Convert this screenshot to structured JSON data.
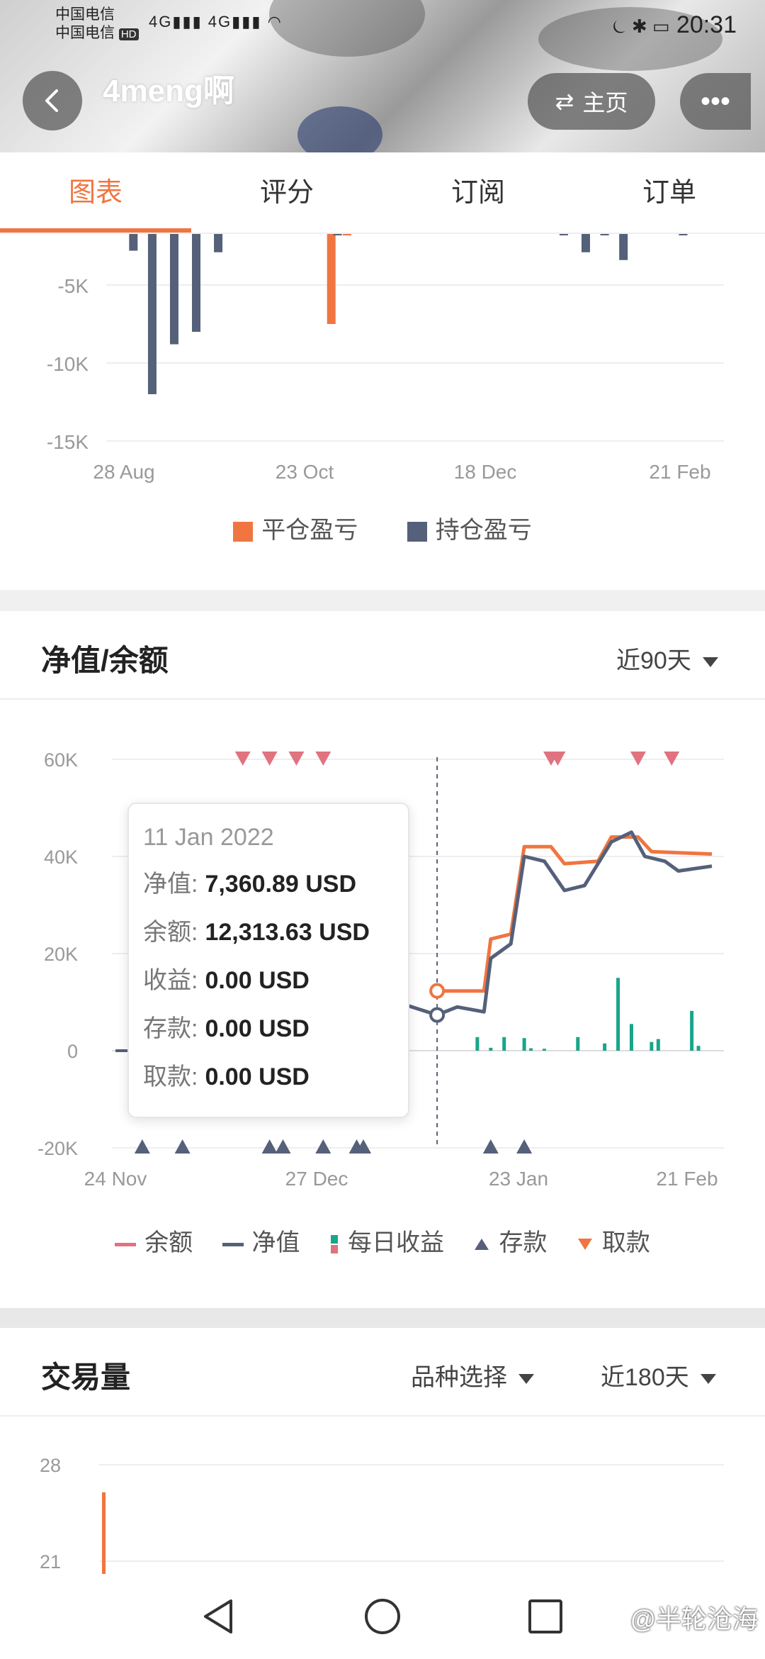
{
  "status_bar": {
    "carrier1": "中国电信",
    "carrier2": "中国电信",
    "carrier2_badge": "HD",
    "network": "4G",
    "time": "20:31"
  },
  "header": {
    "username": "4meng啊",
    "home_label": "主页",
    "more_label": "•••"
  },
  "tabs": [
    {
      "label": "图表",
      "active": true
    },
    {
      "label": "评分",
      "active": false
    },
    {
      "label": "订阅",
      "active": false
    },
    {
      "label": "订单",
      "active": false
    }
  ],
  "pnl_chart": {
    "legend": [
      {
        "label": "平仓盈亏",
        "color": "#f07540"
      },
      {
        "label": "持仓盈亏",
        "color": "#55607a"
      }
    ]
  },
  "equity_section": {
    "title": "净值/余额",
    "range_select": "近90天",
    "tooltip": {
      "date": "11 Jan 2022",
      "rows": [
        {
          "label": "净值:",
          "value": "7,360.89 USD"
        },
        {
          "label": "余额:",
          "value": "12,313.63 USD"
        },
        {
          "label": "收益:",
          "value": "0.00 USD"
        },
        {
          "label": "存款:",
          "value": "0.00 USD"
        },
        {
          "label": "取款:",
          "value": "0.00 USD"
        }
      ]
    },
    "legend": [
      {
        "label": "余额",
        "color": "#e0737f",
        "marker": "dash"
      },
      {
        "label": "净值",
        "color": "#55607a",
        "marker": "dash"
      },
      {
        "label": "每日收益",
        "color": "#1aa58a",
        "marker": "bars"
      },
      {
        "label": "存款",
        "color": "#55607a",
        "marker": "triangle-up"
      },
      {
        "label": "取款",
        "color": "#f07540",
        "marker": "triangle-down"
      }
    ]
  },
  "volume_section": {
    "title": "交易量",
    "symbol_select": "品种选择",
    "range_select": "近180天"
  },
  "watermark": "@半轮沧海",
  "chart_data": [
    {
      "type": "bar",
      "x_ticks": [
        "28 Aug",
        "23 Oct",
        "18 Dec",
        "21 Feb"
      ],
      "y_ticks": [
        "-5K",
        "-10K",
        "-15K"
      ],
      "ylim": [
        -15000,
        0
      ],
      "legend_position": "bottom",
      "series": [
        {
          "name": "平仓盈亏",
          "color": "#f07540",
          "points": [
            {
              "x": "2021-11-02",
              "y": -7500
            },
            {
              "x": "2021-11-07",
              "y": -1200
            }
          ]
        },
        {
          "name": "持仓盈亏",
          "color": "#55607a",
          "points": [
            {
              "x": "2021-08-31",
              "y": -2800
            },
            {
              "x": "2021-09-06",
              "y": -12000
            },
            {
              "x": "2021-09-13",
              "y": -8800
            },
            {
              "x": "2021-09-20",
              "y": -8000
            },
            {
              "x": "2021-09-27",
              "y": -2900
            },
            {
              "x": "2021-11-04",
              "y": -800
            },
            {
              "x": "2022-01-15",
              "y": -1600
            },
            {
              "x": "2022-01-22",
              "y": -2900
            },
            {
              "x": "2022-01-28",
              "y": -1000
            },
            {
              "x": "2022-02-03",
              "y": -3400
            },
            {
              "x": "2022-02-22",
              "y": -900
            }
          ]
        }
      ]
    },
    {
      "type": "line",
      "x_ticks": [
        "24 Nov",
        "27 Dec",
        "23 Jan",
        "21 Feb"
      ],
      "y_ticks": [
        "60K",
        "40K",
        "20K",
        "0",
        "-20K"
      ],
      "ylim": [
        -20000,
        60000
      ],
      "grid": true,
      "crosshair_x": "2022-01-11",
      "legend_position": "bottom",
      "series": [
        {
          "name": "余额",
          "color": "#f07540",
          "points": [
            {
              "x": "2022-01-11",
              "y": 12313
            },
            {
              "x": "2022-01-18",
              "y": 12313
            },
            {
              "x": "2022-01-19",
              "y": 23000
            },
            {
              "x": "2022-01-22",
              "y": 24000
            },
            {
              "x": "2022-01-24",
              "y": 42000
            },
            {
              "x": "2022-01-28",
              "y": 42000
            },
            {
              "x": "2022-01-30",
              "y": 38500
            },
            {
              "x": "2022-02-04",
              "y": 39000
            },
            {
              "x": "2022-02-06",
              "y": 44000
            },
            {
              "x": "2022-02-10",
              "y": 44000
            },
            {
              "x": "2022-02-12",
              "y": 41000
            },
            {
              "x": "2022-02-21",
              "y": 40500
            }
          ]
        },
        {
          "name": "净值",
          "color": "#55607a",
          "points": [
            {
              "x": "2022-01-05",
              "y": 10000
            },
            {
              "x": "2022-01-11",
              "y": 7360
            },
            {
              "x": "2022-01-14",
              "y": 9000
            },
            {
              "x": "2022-01-18",
              "y": 8000
            },
            {
              "x": "2022-01-19",
              "y": 19000
            },
            {
              "x": "2022-01-22",
              "y": 22000
            },
            {
              "x": "2022-01-24",
              "y": 40000
            },
            {
              "x": "2022-01-27",
              "y": 39000
            },
            {
              "x": "2022-01-30",
              "y": 33000
            },
            {
              "x": "2022-02-02",
              "y": 34000
            },
            {
              "x": "2022-02-06",
              "y": 43000
            },
            {
              "x": "2022-02-09",
              "y": 45000
            },
            {
              "x": "2022-02-11",
              "y": 40000
            },
            {
              "x": "2022-02-14",
              "y": 39000
            },
            {
              "x": "2022-02-16",
              "y": 37000
            },
            {
              "x": "2022-02-21",
              "y": 38000
            }
          ]
        },
        {
          "name": "每日收益",
          "color": "#1aa58a",
          "kind": "bar",
          "points": [
            {
              "x": "2022-01-17",
              "y": 2800
            },
            {
              "x": "2022-01-19",
              "y": 600
            },
            {
              "x": "2022-01-21",
              "y": 2800
            },
            {
              "x": "2022-01-24",
              "y": 2600
            },
            {
              "x": "2022-01-25",
              "y": 500
            },
            {
              "x": "2022-01-27",
              "y": 400
            },
            {
              "x": "2022-02-01",
              "y": 2800
            },
            {
              "x": "2022-02-05",
              "y": 1500
            },
            {
              "x": "2022-02-07",
              "y": 15000
            },
            {
              "x": "2022-02-09",
              "y": 5500
            },
            {
              "x": "2022-02-12",
              "y": 1800
            },
            {
              "x": "2022-02-13",
              "y": 2400
            },
            {
              "x": "2022-02-18",
              "y": 8200
            },
            {
              "x": "2022-02-19",
              "y": 1000
            }
          ]
        },
        {
          "name": "存款",
          "color": "#55607a",
          "kind": "marker-bottom",
          "x": [
            "2021-11-28",
            "2021-12-04",
            "2021-12-17",
            "2021-12-19",
            "2021-12-25",
            "2021-12-30",
            "2021-12-31",
            "2022-01-19",
            "2022-01-24"
          ]
        },
        {
          "name": "取款",
          "color": "#e0737f",
          "kind": "marker-top",
          "x": [
            "2021-12-13",
            "2021-12-17",
            "2021-12-21",
            "2021-12-25",
            "2022-01-28",
            "2022-01-29",
            "2022-02-10",
            "2022-02-15"
          ]
        }
      ]
    },
    {
      "type": "bar",
      "y_ticks": [
        "28",
        "21"
      ],
      "grid": true,
      "series": [
        {
          "name": "交易量",
          "color": "#f07540",
          "values": [
            26
          ]
        }
      ]
    }
  ]
}
